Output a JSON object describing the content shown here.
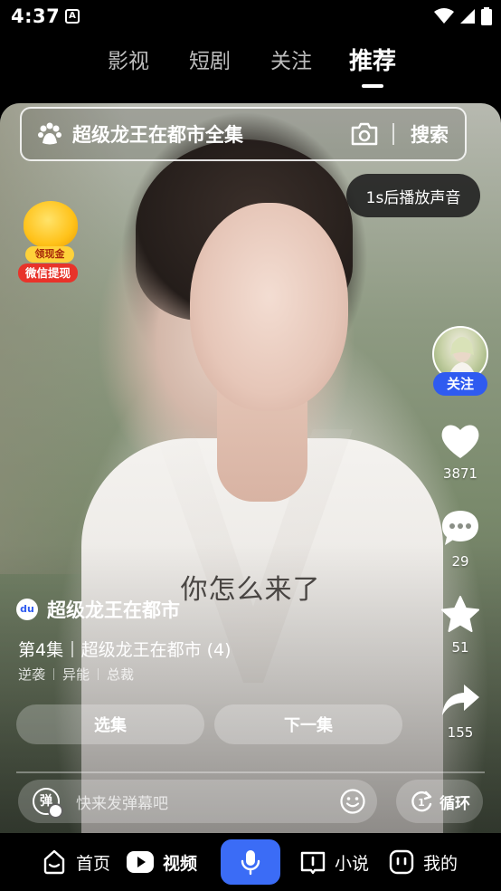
{
  "status_bar": {
    "time": "4:37",
    "notification_glyph": "A"
  },
  "top_tabs": [
    {
      "label": "影视",
      "active": false
    },
    {
      "label": "短剧",
      "active": false
    },
    {
      "label": "关注",
      "active": false
    },
    {
      "label": "推荐",
      "active": true
    }
  ],
  "search": {
    "query": "超级龙王在都市全集",
    "button_label": "搜索"
  },
  "sound_tip": "1s后播放声音",
  "cash_widget": {
    "tag": "领现金",
    "label": "微信提现"
  },
  "subtitle": "你怎么来了",
  "creator": {
    "follow_label": "关注"
  },
  "actions": {
    "likes": "3871",
    "comments": "29",
    "favorites": "51",
    "shares": "155"
  },
  "show": {
    "logo_text": "du",
    "title": "超级龙王在都市",
    "episode": "第4集",
    "episode_title": "超级龙王在都市 (4)",
    "tags": [
      "逆袭",
      "异能",
      "总裁"
    ]
  },
  "buttons": {
    "select_episode": "选集",
    "next_episode": "下一集"
  },
  "danmaku": {
    "toggle_label": "弹",
    "placeholder": "快来发弹幕吧",
    "loop_label": "循环",
    "loop_icon_text": "1"
  },
  "bottom_nav": [
    {
      "label": "首页",
      "active": false
    },
    {
      "label": "视频",
      "active": true
    },
    {
      "label": "小说",
      "active": false
    },
    {
      "label": "我的",
      "active": false
    }
  ],
  "colors": {
    "accent_blue": "#3b6cf6",
    "follow_blue": "#2f5bf0",
    "cash_red": "#e8332a",
    "cash_gold": "#ffc21a"
  }
}
